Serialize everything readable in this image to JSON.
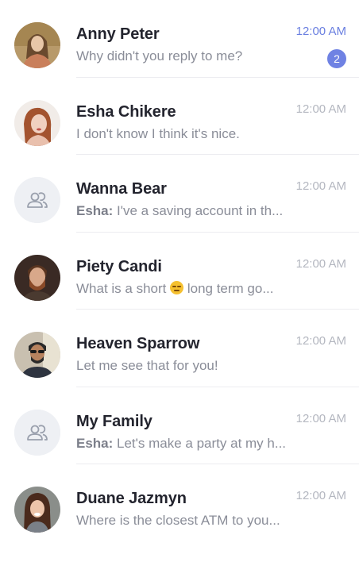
{
  "chats": [
    {
      "name": "Anny Peter",
      "time": "12:00 AM",
      "preview": "Why didn't you reply to me?",
      "badge": "2",
      "avatar": "photo-woman-autumn"
    },
    {
      "name": "Esha Chikere",
      "time": "12:00 AM",
      "preview": "I don't know I think it's nice.",
      "avatar": "photo-woman-redhead"
    },
    {
      "name": "Wanna Bear",
      "time": "12:00 AM",
      "sender": "Esha:",
      "preview": " I've a saving account in th...",
      "avatar": "group-icon"
    },
    {
      "name": "Piety Candi",
      "time": "12:00 AM",
      "preview_before": "What is a short ",
      "preview_after": " long term go...",
      "emoji": "pensive-face",
      "avatar": "photo-man-beard"
    },
    {
      "name": "Heaven Sparrow",
      "time": "12:00 AM",
      "preview": "Let me see that for you!",
      "avatar": "photo-man-sunglasses"
    },
    {
      "name": "My Family",
      "time": "12:00 AM",
      "sender": "Esha:",
      "preview": " Let's make a party at my h...",
      "avatar": "group-icon"
    },
    {
      "name": "Duane Jazmyn",
      "time": "12:00 AM",
      "preview": "Where is the closest ATM to you...",
      "avatar": "photo-woman-brunette"
    }
  ],
  "colors": {
    "accent": "#6f82e3",
    "time_active": "#6a7fe0",
    "time": "#b4b7c0",
    "text": "#23242e",
    "muted": "#8a8d98"
  }
}
